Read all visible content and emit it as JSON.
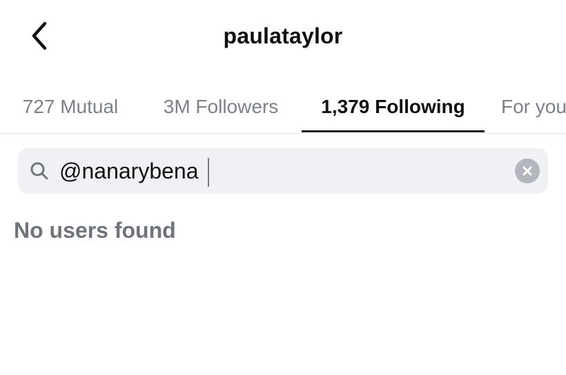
{
  "header": {
    "title": "paulataylor",
    "back_icon": "chevron-left-icon"
  },
  "tabs": [
    {
      "label": "727 Mutual",
      "active": false
    },
    {
      "label": "3M Followers",
      "active": false
    },
    {
      "label": "1,379 Following",
      "active": true
    },
    {
      "label": "For you",
      "active": false
    }
  ],
  "search": {
    "value": "@nanarybena",
    "icon": "search-icon",
    "clear_icon": "clear-icon"
  },
  "results": {
    "empty_message": "No users found"
  },
  "colors": {
    "text_primary": "#111111",
    "text_secondary": "#7b8089",
    "search_bg": "#eff1f4",
    "clear_button": "#b3b6bc"
  }
}
